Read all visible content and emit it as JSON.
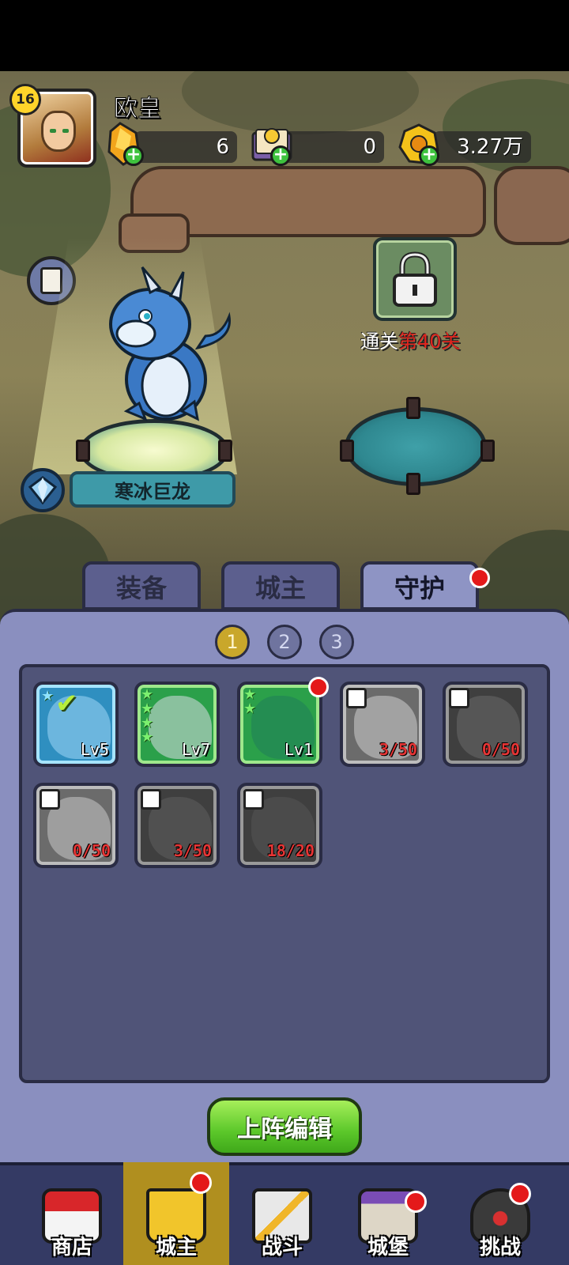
{
  "player": {
    "level": "16",
    "name": "欧皇"
  },
  "resources": [
    {
      "name": "amber-crystal",
      "value": "6"
    },
    {
      "name": "spell-book",
      "value": "0"
    },
    {
      "name": "gold-coin",
      "value": "3.27万"
    }
  ],
  "scene": {
    "unlock_prefix": "通关",
    "unlock_level": "第40关",
    "dragon_name": "寒冰巨龙"
  },
  "tabs": [
    {
      "label": "装备",
      "active": false
    },
    {
      "label": "城主",
      "active": false
    },
    {
      "label": "守护",
      "active": true,
      "badge": true
    }
  ],
  "pages": [
    "1",
    "2",
    "3"
  ],
  "active_page": "1",
  "cards": [
    {
      "state": "owned",
      "color": "blue",
      "level": "Lv5",
      "stars": 1,
      "selected": true
    },
    {
      "state": "owned",
      "color": "green",
      "level": "Lv7",
      "stars": 4
    },
    {
      "state": "owned",
      "color": "green",
      "level": "Lv1",
      "stars": 2,
      "badge": true
    },
    {
      "state": "locked",
      "color": "gray",
      "fragments": "3/50"
    },
    {
      "state": "locked",
      "color": "dark",
      "fragments": "0/50"
    },
    {
      "state": "locked",
      "color": "gray",
      "fragments": "0/50"
    },
    {
      "state": "locked",
      "color": "dark",
      "fragments": "3/50"
    },
    {
      "state": "locked",
      "color": "dark",
      "fragments": "18/20"
    }
  ],
  "edit_button": "上阵编辑",
  "nav": [
    {
      "label": "商店",
      "icon": "shop-icon",
      "active": false,
      "badge": false
    },
    {
      "label": "城主",
      "icon": "crown-icon",
      "active": true,
      "badge": true
    },
    {
      "label": "战斗",
      "icon": "crossed-swords-icon",
      "active": false,
      "badge": false
    },
    {
      "label": "城堡",
      "icon": "castle-icon",
      "active": false,
      "badge": true
    },
    {
      "label": "挑战",
      "icon": "demon-helmet-icon",
      "active": false,
      "badge": true
    }
  ],
  "colors": {
    "accent_gold": "#c9a72b",
    "badge_red": "#e4191a",
    "panel": "#8a8fbf"
  }
}
